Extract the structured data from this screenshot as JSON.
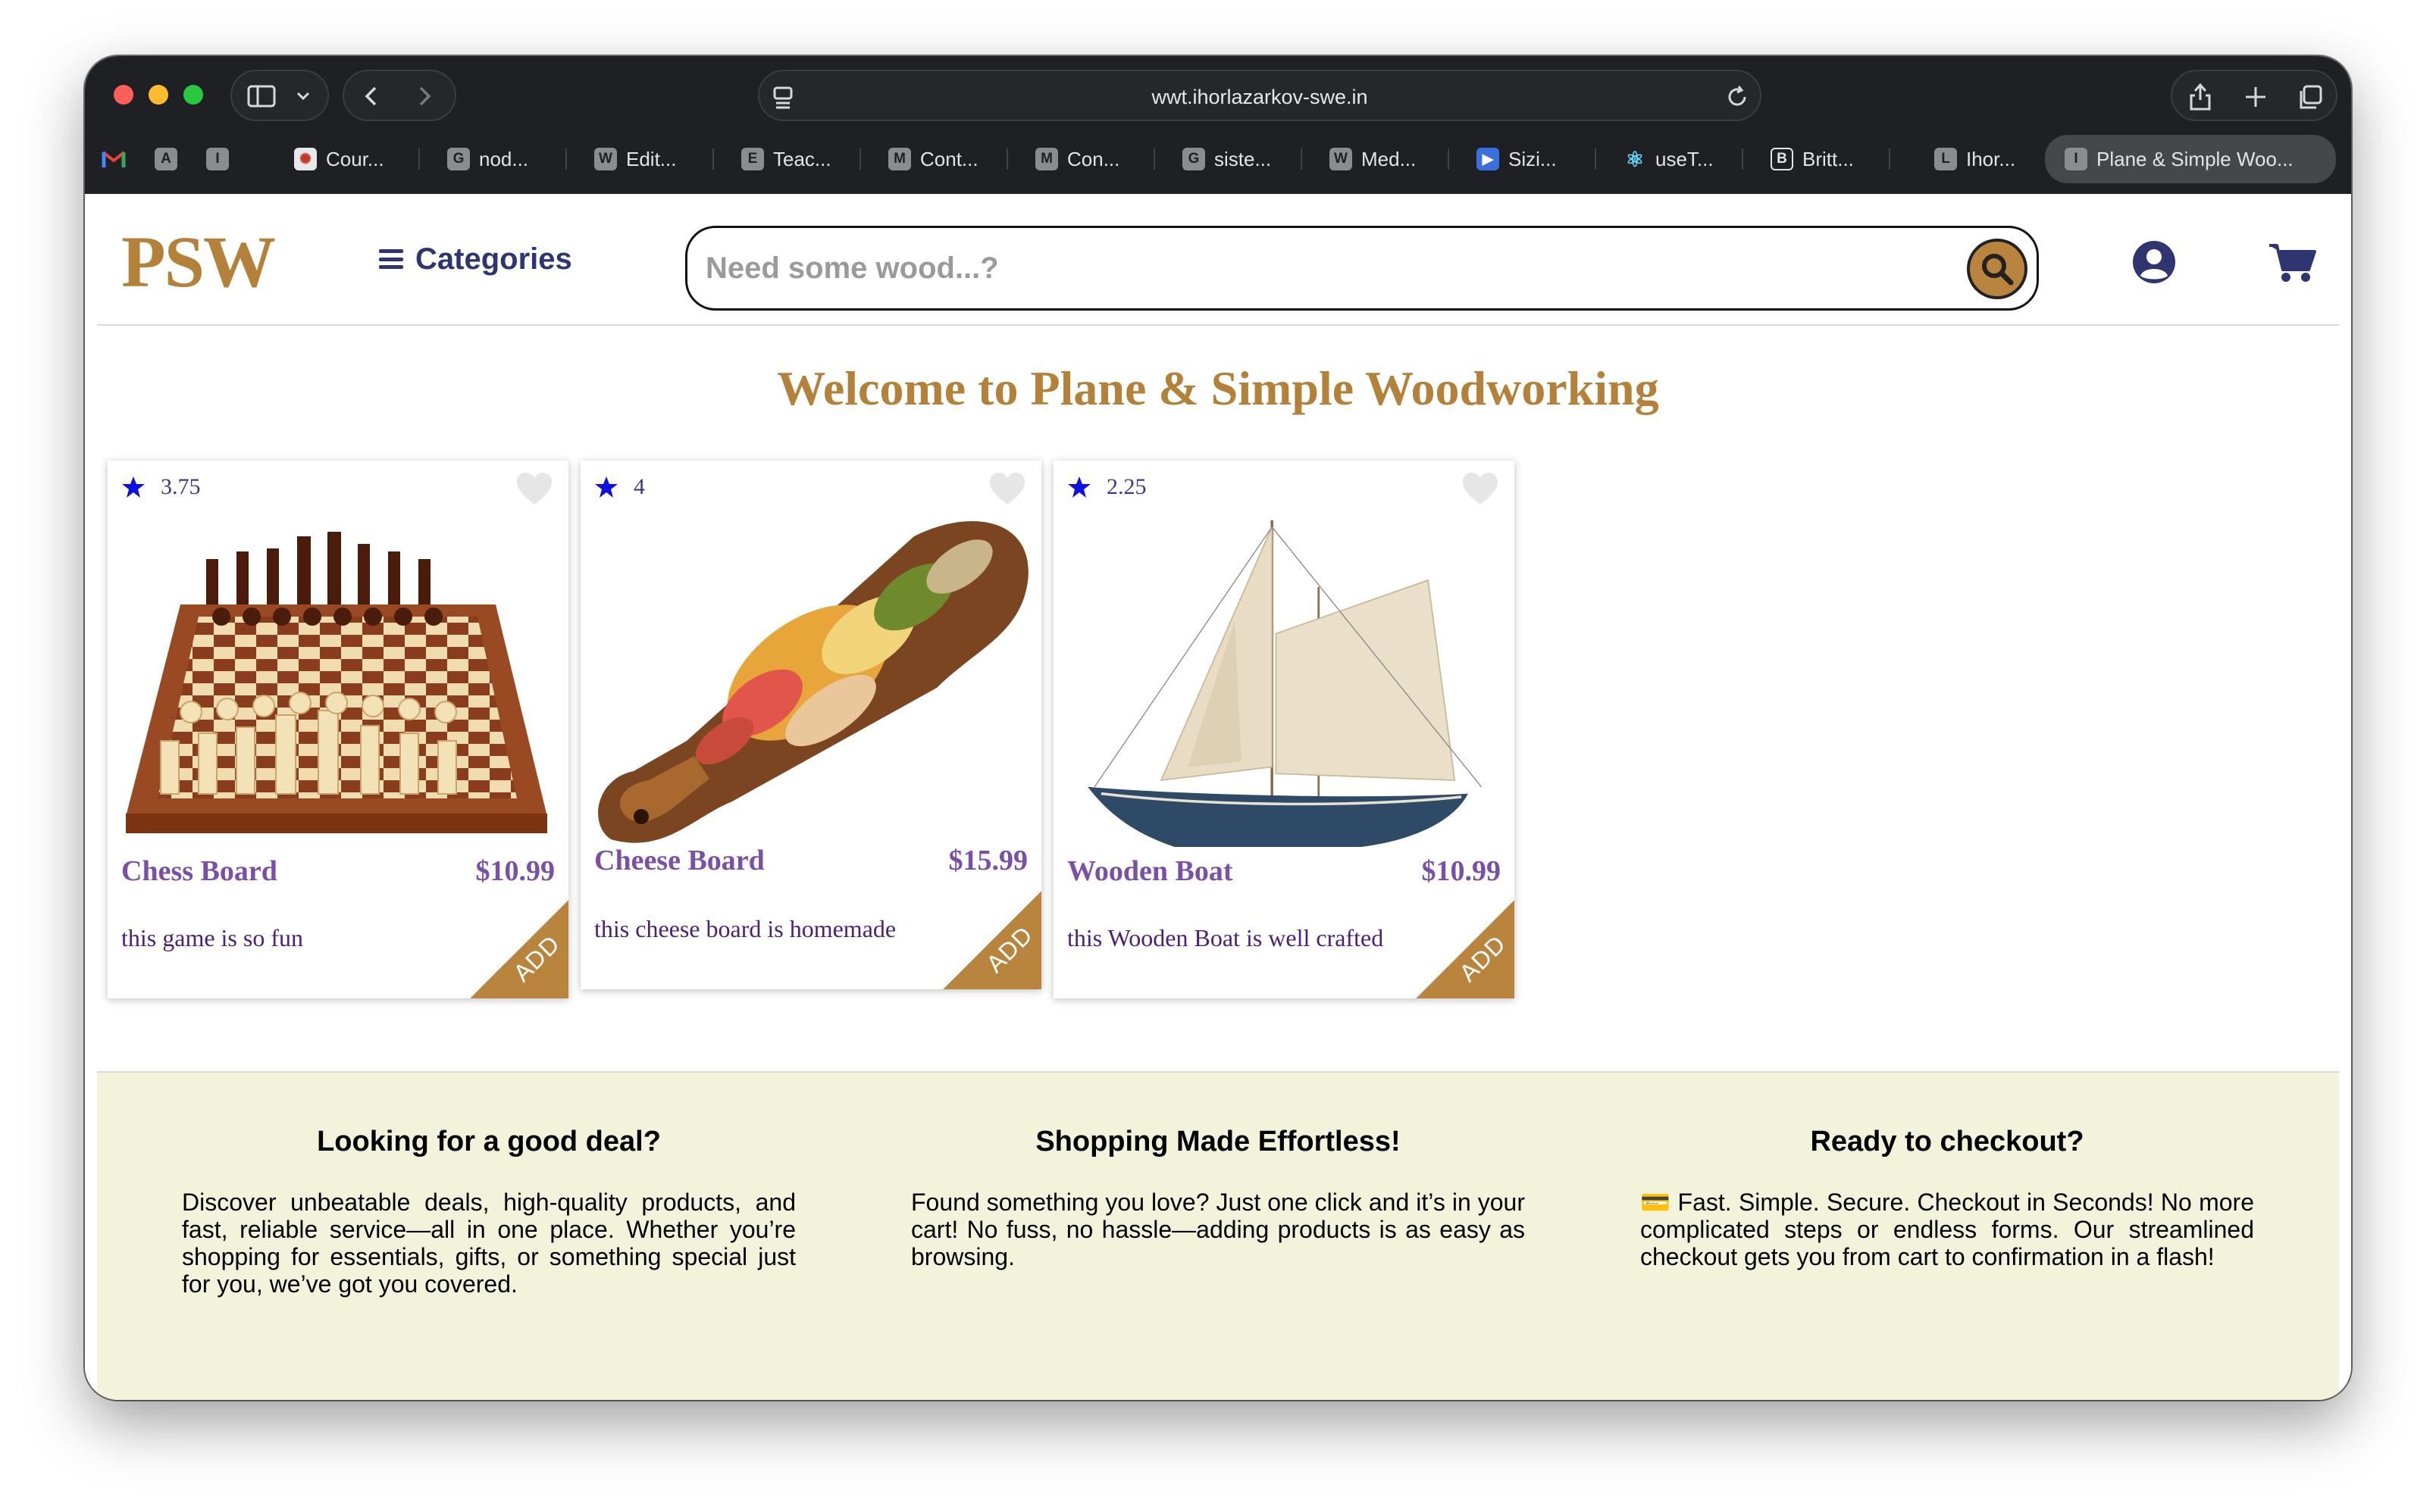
{
  "browser": {
    "url": "wwt.ihorlazarkov-swe.in",
    "pinned_tabs": [
      {
        "icon": "gmail-icon",
        "label": "M"
      },
      {
        "icon": "a-icon",
        "label": "A"
      },
      {
        "icon": "i-icon",
        "label": "I"
      }
    ],
    "tabs": [
      {
        "fav": "✺",
        "label": "Cour..."
      },
      {
        "fav": "G",
        "label": "nod..."
      },
      {
        "fav": "W",
        "label": "Edit..."
      },
      {
        "fav": "E",
        "label": "Teac..."
      },
      {
        "fav": "M",
        "label": "Cont..."
      },
      {
        "fav": "M",
        "label": "Con..."
      },
      {
        "fav": "G",
        "label": "siste..."
      },
      {
        "fav": "W",
        "label": "Med..."
      },
      {
        "fav": "▶",
        "label": "Sizi..."
      },
      {
        "fav": "⚛",
        "label": "useT..."
      },
      {
        "fav": "B",
        "label": "Britt..."
      },
      {
        "fav": "L",
        "label": "Ihor..."
      },
      {
        "fav": "I",
        "label": "Plane & Simple Woo..."
      }
    ]
  },
  "header": {
    "logo": "PSW",
    "categories_label": "Categories",
    "search_placeholder": "Need some wood...?"
  },
  "main": {
    "welcome": "Welcome to Plane & Simple Woodworking",
    "products": [
      {
        "rating": "3.75",
        "name": "Chess Board",
        "price": "$10.99",
        "description": "this game is so fun",
        "add_label": "ADD"
      },
      {
        "rating": "4",
        "name": "Cheese Board",
        "price": "$15.99",
        "description": "this cheese board is homemade",
        "add_label": "ADD"
      },
      {
        "rating": "2.25",
        "name": "Wooden Boat",
        "price": "$10.99",
        "description": "this Wooden Boat is well crafted",
        "add_label": "ADD"
      }
    ]
  },
  "footer": {
    "columns": [
      {
        "title": "Looking for a good deal?",
        "text": "Discover unbeatable deals, high-quality products, and fast, reliable service—all in one place. Whether you’re shopping for essentials, gifts, or something special just for you, we’ve got you covered."
      },
      {
        "title": "Shopping Made Effortless!",
        "text": "Found something you love? Just one click and it’s in your cart! No fuss, no hassle—adding products is as easy as browsing."
      },
      {
        "title": "Ready to checkout?",
        "text": "💳 Fast. Simple. Secure. Checkout in Seconds! No more complicated steps or endless forms. Our streamlined checkout gets you from cart to confirmation in a flash!"
      }
    ]
  },
  "colors": {
    "brand_gold": "#b3813a",
    "nav_text": "#2f3570",
    "product_text": "#7a4fa8",
    "footer_bg": "#f3f3dc",
    "star": "#1010e0"
  }
}
